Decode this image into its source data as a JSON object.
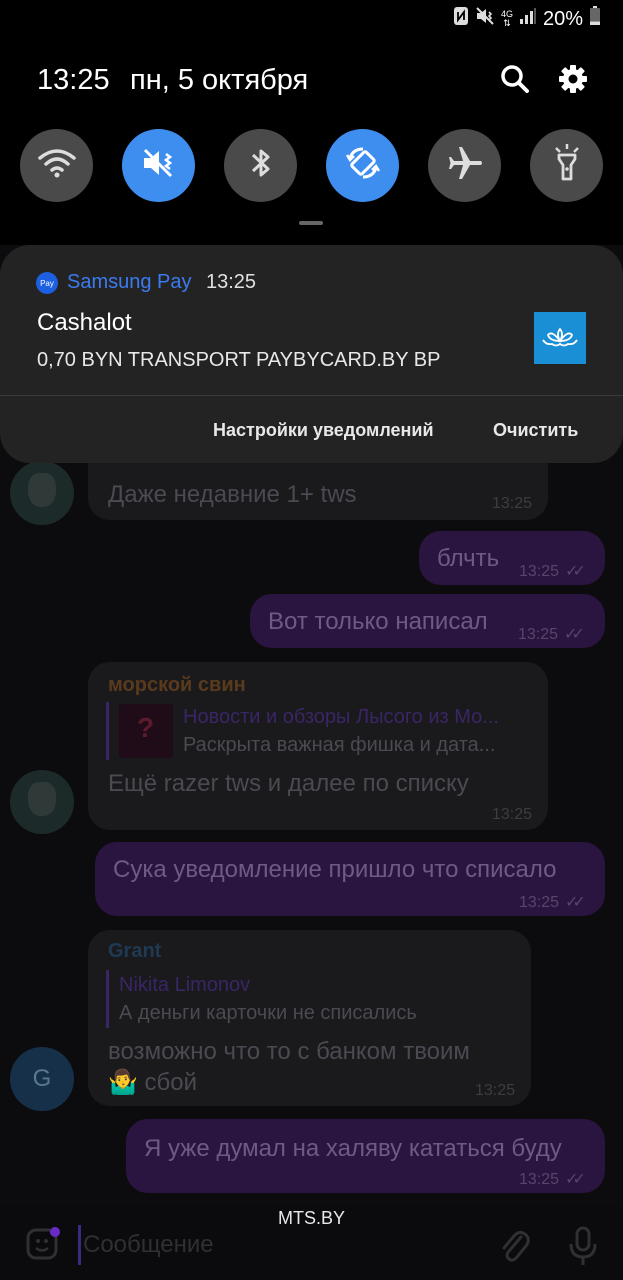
{
  "status_bar": {
    "network_type": "4G",
    "battery_percent": "20%",
    "battery_level": 0.2,
    "icons": [
      "nfc-icon",
      "vibrate-icon",
      "network-4g-icon",
      "signal-icon",
      "battery-icon"
    ]
  },
  "shade": {
    "time": "13:25",
    "date": "пн, 5 октября",
    "header_icons": [
      "search-icon",
      "settings-icon"
    ],
    "quick_settings": [
      {
        "name": "wifi",
        "icon": "wifi-icon",
        "on": false
      },
      {
        "name": "sound",
        "icon": "vibrate-icon",
        "on": true
      },
      {
        "name": "bluetooth",
        "icon": "bluetooth-icon",
        "on": false
      },
      {
        "name": "auto-rotate",
        "icon": "rotate-icon",
        "on": true
      },
      {
        "name": "airplane",
        "icon": "airplane-icon",
        "on": false
      },
      {
        "name": "flashlight",
        "icon": "flashlight-icon",
        "on": false
      }
    ],
    "accent_color": "#3e8ef0"
  },
  "notification": {
    "app_icon_label": "Pay",
    "app_name": "Samsung Pay",
    "time": "13:25",
    "title": "Cashalot",
    "text": "0,70 BYN TRANSPORT PAYBYCARD.BY BP",
    "settings_button": "Настройки уведомлений",
    "clear_button": "Очистить",
    "app_color": "#3b7bf0"
  },
  "chat": {
    "messages": [
      {
        "direction": "in",
        "text": "Даже недавние 1+ tws",
        "time": "13:25"
      },
      {
        "direction": "out",
        "text": "блчть",
        "time": "13:25"
      },
      {
        "direction": "out",
        "text": "Вот только написал",
        "time": "13:25"
      },
      {
        "direction": "in",
        "sender": "морской свин",
        "reply_name": "Новости и обзоры Лысого из Мо...",
        "reply_text": "Раскрыта важная фишка и дата...",
        "text": "Ещё razer tws и далее по списку",
        "time": "13:25"
      },
      {
        "direction": "out",
        "text": "Сука уведомление пришло что списало",
        "time": "13:25"
      },
      {
        "direction": "in",
        "sender": "Grant",
        "avatar_letter": "G",
        "reply_name": "Nikita Limonov",
        "reply_text": "А деньги  карточки не списались",
        "text_line1": "возможно что то с банком твоим",
        "text_line2": "🤷‍♂️ сбой",
        "time": "13:25"
      },
      {
        "direction": "out",
        "text": "Я уже думал на халяву кататься буду",
        "time": "13:25"
      }
    ],
    "sender_colors": {
      "морской свин": "#5a3a1c",
      "Grant": "#1f3a52"
    }
  },
  "input_bar": {
    "placeholder": "Сообщение",
    "icons": [
      "emoji-icon",
      "attach-icon",
      "mic-icon"
    ]
  },
  "carrier": "MTS.BY"
}
